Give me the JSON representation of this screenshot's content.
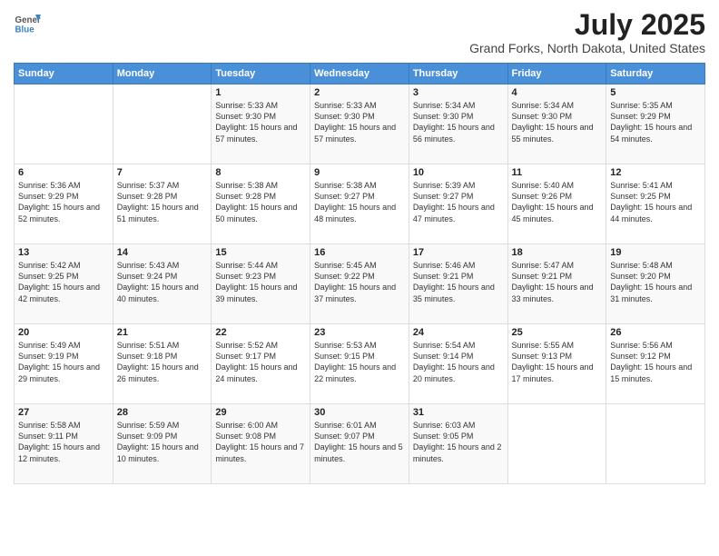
{
  "logo": {
    "line1": "General",
    "line2": "Blue"
  },
  "title": "July 2025",
  "subtitle": "Grand Forks, North Dakota, United States",
  "headers": [
    "Sunday",
    "Monday",
    "Tuesday",
    "Wednesday",
    "Thursday",
    "Friday",
    "Saturday"
  ],
  "weeks": [
    [
      {
        "day": "",
        "sunrise": "",
        "sunset": "",
        "daylight": ""
      },
      {
        "day": "",
        "sunrise": "",
        "sunset": "",
        "daylight": ""
      },
      {
        "day": "1",
        "sunrise": "Sunrise: 5:33 AM",
        "sunset": "Sunset: 9:30 PM",
        "daylight": "Daylight: 15 hours and 57 minutes."
      },
      {
        "day": "2",
        "sunrise": "Sunrise: 5:33 AM",
        "sunset": "Sunset: 9:30 PM",
        "daylight": "Daylight: 15 hours and 57 minutes."
      },
      {
        "day": "3",
        "sunrise": "Sunrise: 5:34 AM",
        "sunset": "Sunset: 9:30 PM",
        "daylight": "Daylight: 15 hours and 56 minutes."
      },
      {
        "day": "4",
        "sunrise": "Sunrise: 5:34 AM",
        "sunset": "Sunset: 9:30 PM",
        "daylight": "Daylight: 15 hours and 55 minutes."
      },
      {
        "day": "5",
        "sunrise": "Sunrise: 5:35 AM",
        "sunset": "Sunset: 9:29 PM",
        "daylight": "Daylight: 15 hours and 54 minutes."
      }
    ],
    [
      {
        "day": "6",
        "sunrise": "Sunrise: 5:36 AM",
        "sunset": "Sunset: 9:29 PM",
        "daylight": "Daylight: 15 hours and 52 minutes."
      },
      {
        "day": "7",
        "sunrise": "Sunrise: 5:37 AM",
        "sunset": "Sunset: 9:28 PM",
        "daylight": "Daylight: 15 hours and 51 minutes."
      },
      {
        "day": "8",
        "sunrise": "Sunrise: 5:38 AM",
        "sunset": "Sunset: 9:28 PM",
        "daylight": "Daylight: 15 hours and 50 minutes."
      },
      {
        "day": "9",
        "sunrise": "Sunrise: 5:38 AM",
        "sunset": "Sunset: 9:27 PM",
        "daylight": "Daylight: 15 hours and 48 minutes."
      },
      {
        "day": "10",
        "sunrise": "Sunrise: 5:39 AM",
        "sunset": "Sunset: 9:27 PM",
        "daylight": "Daylight: 15 hours and 47 minutes."
      },
      {
        "day": "11",
        "sunrise": "Sunrise: 5:40 AM",
        "sunset": "Sunset: 9:26 PM",
        "daylight": "Daylight: 15 hours and 45 minutes."
      },
      {
        "day": "12",
        "sunrise": "Sunrise: 5:41 AM",
        "sunset": "Sunset: 9:25 PM",
        "daylight": "Daylight: 15 hours and 44 minutes."
      }
    ],
    [
      {
        "day": "13",
        "sunrise": "Sunrise: 5:42 AM",
        "sunset": "Sunset: 9:25 PM",
        "daylight": "Daylight: 15 hours and 42 minutes."
      },
      {
        "day": "14",
        "sunrise": "Sunrise: 5:43 AM",
        "sunset": "Sunset: 9:24 PM",
        "daylight": "Daylight: 15 hours and 40 minutes."
      },
      {
        "day": "15",
        "sunrise": "Sunrise: 5:44 AM",
        "sunset": "Sunset: 9:23 PM",
        "daylight": "Daylight: 15 hours and 39 minutes."
      },
      {
        "day": "16",
        "sunrise": "Sunrise: 5:45 AM",
        "sunset": "Sunset: 9:22 PM",
        "daylight": "Daylight: 15 hours and 37 minutes."
      },
      {
        "day": "17",
        "sunrise": "Sunrise: 5:46 AM",
        "sunset": "Sunset: 9:21 PM",
        "daylight": "Daylight: 15 hours and 35 minutes."
      },
      {
        "day": "18",
        "sunrise": "Sunrise: 5:47 AM",
        "sunset": "Sunset: 9:21 PM",
        "daylight": "Daylight: 15 hours and 33 minutes."
      },
      {
        "day": "19",
        "sunrise": "Sunrise: 5:48 AM",
        "sunset": "Sunset: 9:20 PM",
        "daylight": "Daylight: 15 hours and 31 minutes."
      }
    ],
    [
      {
        "day": "20",
        "sunrise": "Sunrise: 5:49 AM",
        "sunset": "Sunset: 9:19 PM",
        "daylight": "Daylight: 15 hours and 29 minutes."
      },
      {
        "day": "21",
        "sunrise": "Sunrise: 5:51 AM",
        "sunset": "Sunset: 9:18 PM",
        "daylight": "Daylight: 15 hours and 26 minutes."
      },
      {
        "day": "22",
        "sunrise": "Sunrise: 5:52 AM",
        "sunset": "Sunset: 9:17 PM",
        "daylight": "Daylight: 15 hours and 24 minutes."
      },
      {
        "day": "23",
        "sunrise": "Sunrise: 5:53 AM",
        "sunset": "Sunset: 9:15 PM",
        "daylight": "Daylight: 15 hours and 22 minutes."
      },
      {
        "day": "24",
        "sunrise": "Sunrise: 5:54 AM",
        "sunset": "Sunset: 9:14 PM",
        "daylight": "Daylight: 15 hours and 20 minutes."
      },
      {
        "day": "25",
        "sunrise": "Sunrise: 5:55 AM",
        "sunset": "Sunset: 9:13 PM",
        "daylight": "Daylight: 15 hours and 17 minutes."
      },
      {
        "day": "26",
        "sunrise": "Sunrise: 5:56 AM",
        "sunset": "Sunset: 9:12 PM",
        "daylight": "Daylight: 15 hours and 15 minutes."
      }
    ],
    [
      {
        "day": "27",
        "sunrise": "Sunrise: 5:58 AM",
        "sunset": "Sunset: 9:11 PM",
        "daylight": "Daylight: 15 hours and 12 minutes."
      },
      {
        "day": "28",
        "sunrise": "Sunrise: 5:59 AM",
        "sunset": "Sunset: 9:09 PM",
        "daylight": "Daylight: 15 hours and 10 minutes."
      },
      {
        "day": "29",
        "sunrise": "Sunrise: 6:00 AM",
        "sunset": "Sunset: 9:08 PM",
        "daylight": "Daylight: 15 hours and 7 minutes."
      },
      {
        "day": "30",
        "sunrise": "Sunrise: 6:01 AM",
        "sunset": "Sunset: 9:07 PM",
        "daylight": "Daylight: 15 hours and 5 minutes."
      },
      {
        "day": "31",
        "sunrise": "Sunrise: 6:03 AM",
        "sunset": "Sunset: 9:05 PM",
        "daylight": "Daylight: 15 hours and 2 minutes."
      },
      {
        "day": "",
        "sunrise": "",
        "sunset": "",
        "daylight": ""
      },
      {
        "day": "",
        "sunrise": "",
        "sunset": "",
        "daylight": ""
      }
    ]
  ]
}
